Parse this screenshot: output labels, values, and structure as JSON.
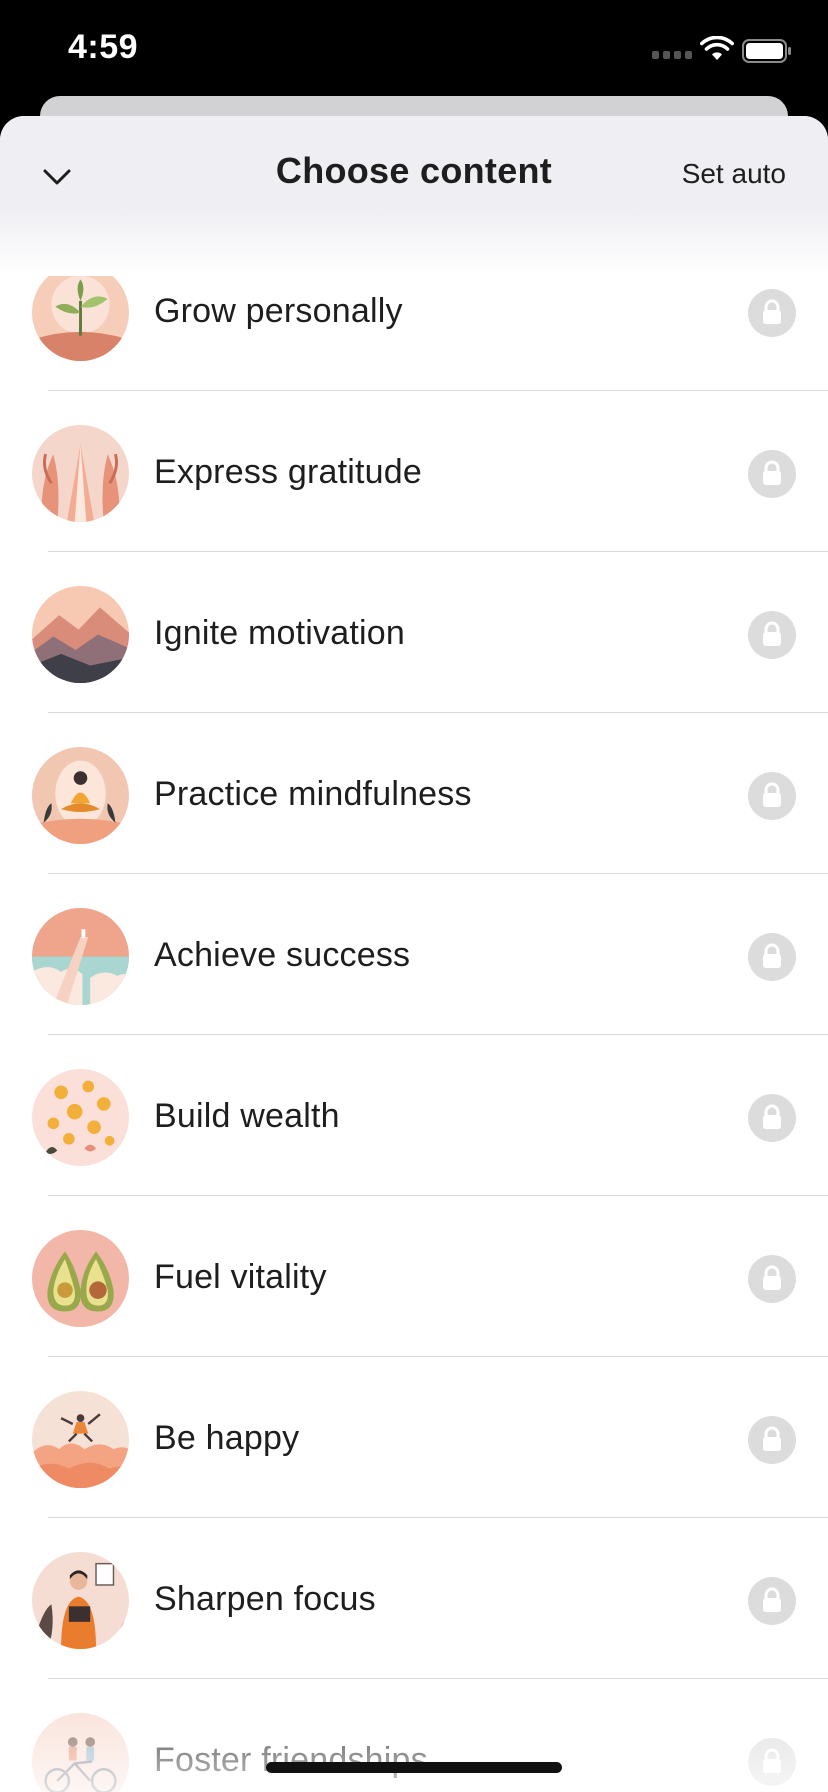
{
  "status_bar": {
    "time": "4:59",
    "icons": [
      "cellular-signal-icon",
      "wifi-icon",
      "battery-icon"
    ]
  },
  "header": {
    "title": "Choose content",
    "action_label": "Set auto",
    "dismiss_icon": "chevron-down-icon"
  },
  "topics": [
    {
      "label": "Grow personally",
      "icon": "sprout-illustration",
      "locked": true
    },
    {
      "label": "Express gratitude",
      "icon": "praying-hands-illustration",
      "locked": true
    },
    {
      "label": "Ignite motivation",
      "icon": "mountains-illustration",
      "locked": true
    },
    {
      "label": "Practice mindfulness",
      "icon": "meditation-illustration",
      "locked": true
    },
    {
      "label": "Achieve success",
      "icon": "stairs-to-sky-illustration",
      "locked": true
    },
    {
      "label": "Build wealth",
      "icon": "gold-coins-illustration",
      "locked": true
    },
    {
      "label": "Fuel vitality",
      "icon": "avocado-illustration",
      "locked": true
    },
    {
      "label": "Be happy",
      "icon": "jumping-person-clouds-illustration",
      "locked": true
    },
    {
      "label": "Sharpen focus",
      "icon": "person-reading-illustration",
      "locked": true
    },
    {
      "label": "Foster friendships",
      "icon": "friends-cycling-illustration",
      "locked": true
    }
  ],
  "colors": {
    "accent_peach": "#f3b9a0",
    "lock_badge": "#dcdcdc",
    "header_bg": "#eeeef3",
    "text": "#1e1e1e"
  }
}
